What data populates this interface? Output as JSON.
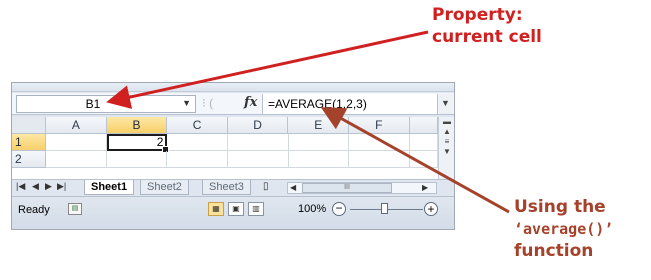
{
  "annotations": {
    "property_line1": "Property:",
    "property_line2": "current cell",
    "function_line1": "Using the",
    "function_code": "‘average()’",
    "function_line3": "function"
  },
  "formula_bar": {
    "name_box_value": "B1",
    "fx_label": "fx",
    "formula": "=AVERAGE(1,2,3)"
  },
  "columns": [
    "A",
    "B",
    "C",
    "D",
    "E",
    "F"
  ],
  "rows": [
    {
      "header": "1",
      "cells": [
        "",
        "2",
        "",
        "",
        "",
        ""
      ]
    },
    {
      "header": "2",
      "cells": [
        "",
        "",
        "",
        "",
        "",
        ""
      ]
    }
  ],
  "active_cell": "B1",
  "sheet_tabs": [
    "Sheet1",
    "Sheet2",
    "Sheet3"
  ],
  "active_sheet": "Sheet1",
  "status": {
    "mode": "Ready",
    "zoom": "100%"
  },
  "colors": {
    "annotation_red": "#d02020",
    "annotation_brown": "#a5422b"
  }
}
